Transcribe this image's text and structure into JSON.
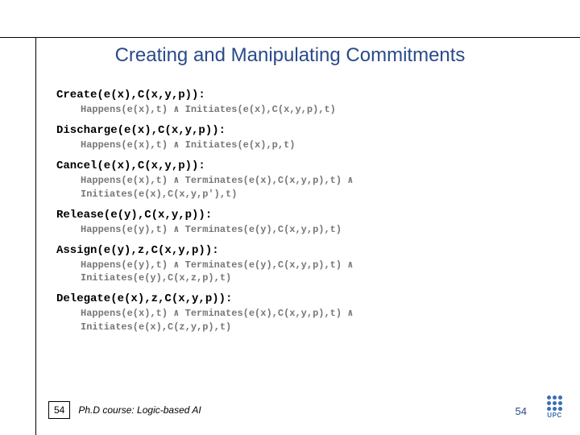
{
  "title": "Creating and Manipulating Commitments",
  "ops": [
    {
      "head": "Create(e(x),C(x,y,p)):",
      "body": "Happens(e(x),t) ∧ Initiates(e(x),C(x,y,p),t)"
    },
    {
      "head": "Discharge(e(x),C(x,y,p)):",
      "body": "Happens(e(x),t) ∧ Initiates(e(x),p,t)"
    },
    {
      "head": "Cancel(e(x),C(x,y,p)):",
      "body": "Happens(e(x),t) ∧ Terminates(e(x),C(x,y,p),t) ∧\nInitiates(e(x),C(x,y,p'),t)"
    },
    {
      "head": "Release(e(y),C(x,y,p)):",
      "body": "Happens(e(y),t) ∧ Terminates(e(y),C(x,y,p),t)"
    },
    {
      "head": "Assign(e(y),z,C(x,y,p)):",
      "body": "Happens(e(y),t) ∧ Terminates(e(y),C(x,y,p),t) ∧\nInitiates(e(y),C(x,z,p),t)"
    },
    {
      "head": "Delegate(e(x),z,C(x,y,p)):",
      "body": "Happens(e(x),t) ∧ Terminates(e(x),C(x,y,p),t) ∧\nInitiates(e(x),C(z,y,p),t)"
    }
  ],
  "footer": {
    "page": "54",
    "course": "Ph.D course: Logic-based AI"
  },
  "page_right": "54",
  "logo_label": "UPC"
}
